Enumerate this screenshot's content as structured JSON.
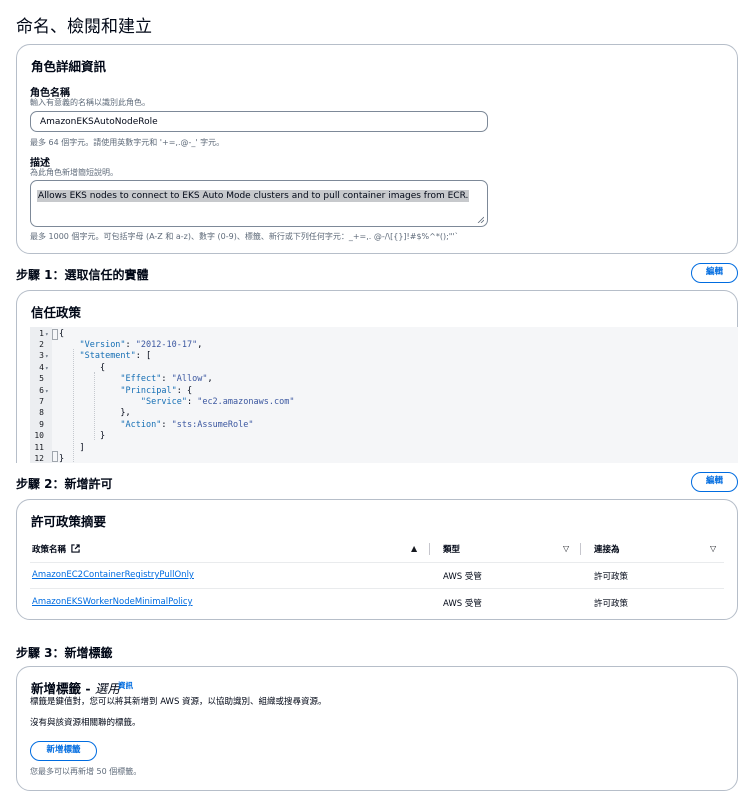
{
  "page_title": "命名、檢閱和建立",
  "role_details": {
    "title": "角色詳細資訊",
    "name_label": "角色名稱",
    "name_desc": "輸入有意義的名稱以識別此角色。",
    "name_value": "AmazonEKSAutoNodeRole",
    "name_hint": "最多 64 個字元。請使用英數字元和 '+=,.@-_' 字元。",
    "desc_label": "描述",
    "desc_desc": "為此角色新增簡短說明。",
    "desc_value": "Allows EKS nodes to connect to EKS Auto Mode clusters and to pull container images from ECR.",
    "desc_hint": "最多 1000 個字元。可包括字母 (A-Z 和 a-z)、數字 (0-9)、標籤、新行或下列任何字元：_+=,. @-/\\[{}]!#$%^*();\"'`"
  },
  "step1": {
    "title": "步驟 1：選取信任的實體",
    "edit_label": "編輯",
    "card_title": "信任政策",
    "code_lines": [
      {
        "n": "1",
        "fold": true,
        "tokens": [
          {
            "t": "{",
            "c": ""
          }
        ]
      },
      {
        "n": "2",
        "fold": false,
        "tokens": [
          {
            "t": "    ",
            "c": ""
          },
          {
            "t": "\"Version\"",
            "c": "k"
          },
          {
            "t": ": ",
            "c": ""
          },
          {
            "t": "\"2012-10-17\"",
            "c": "s2"
          },
          {
            "t": ",",
            "c": ""
          }
        ]
      },
      {
        "n": "3",
        "fold": true,
        "tokens": [
          {
            "t": "    ",
            "c": ""
          },
          {
            "t": "\"Statement\"",
            "c": "k"
          },
          {
            "t": ": [",
            "c": ""
          }
        ]
      },
      {
        "n": "4",
        "fold": true,
        "tokens": [
          {
            "t": "        {",
            "c": ""
          }
        ]
      },
      {
        "n": "5",
        "fold": false,
        "tokens": [
          {
            "t": "            ",
            "c": ""
          },
          {
            "t": "\"Effect\"",
            "c": "k"
          },
          {
            "t": ": ",
            "c": ""
          },
          {
            "t": "\"Allow\"",
            "c": "s2"
          },
          {
            "t": ",",
            "c": ""
          }
        ]
      },
      {
        "n": "6",
        "fold": true,
        "tokens": [
          {
            "t": "            ",
            "c": ""
          },
          {
            "t": "\"Principal\"",
            "c": "k"
          },
          {
            "t": ": {",
            "c": ""
          }
        ]
      },
      {
        "n": "7",
        "fold": false,
        "tokens": [
          {
            "t": "                ",
            "c": ""
          },
          {
            "t": "\"Service\"",
            "c": "k"
          },
          {
            "t": ": ",
            "c": ""
          },
          {
            "t": "\"ec2.amazonaws.com\"",
            "c": "s2"
          }
        ]
      },
      {
        "n": "8",
        "fold": false,
        "tokens": [
          {
            "t": "            },",
            "c": ""
          }
        ]
      },
      {
        "n": "9",
        "fold": false,
        "tokens": [
          {
            "t": "            ",
            "c": ""
          },
          {
            "t": "\"Action\"",
            "c": "k"
          },
          {
            "t": ": ",
            "c": ""
          },
          {
            "t": "\"sts:AssumeRole\"",
            "c": "s2"
          }
        ]
      },
      {
        "n": "10",
        "fold": false,
        "tokens": [
          {
            "t": "        }",
            "c": ""
          }
        ]
      },
      {
        "n": "11",
        "fold": false,
        "tokens": [
          {
            "t": "    ]",
            "c": ""
          }
        ]
      },
      {
        "n": "12",
        "fold": false,
        "tokens": [
          {
            "t": "}",
            "c": ""
          }
        ]
      }
    ]
  },
  "step2": {
    "title": "步驟 2：新增許可",
    "edit_label": "編輯",
    "card_title": "許可政策摘要",
    "columns": [
      "政策名稱",
      "類型",
      "連接為"
    ],
    "rows": [
      {
        "name": "AmazonEC2ContainerRegistryPullOnly",
        "type": "AWS 受管",
        "attached": "許可政策"
      },
      {
        "name": "AmazonEKSWorkerNodeMinimalPolicy",
        "type": "AWS 受管",
        "attached": "許可政策"
      }
    ]
  },
  "step3": {
    "title": "步驟 3：新增標籤",
    "card_title_prefix": "新增標籤 - ",
    "card_title_optional": "選用",
    "info_label": "資訊",
    "tag_desc": "標籤是鍵值對，您可以將其新增到 AWS 資源，以協助識別、組織或搜尋資源。",
    "no_tags": "沒有與該資源相關聯的標籤。",
    "add_label": "新增標籤",
    "limit_hint": "您最多可以再新增 50 個標籤。"
  },
  "colors": {
    "accent": "#006ce0",
    "border": "#b6bec9"
  }
}
